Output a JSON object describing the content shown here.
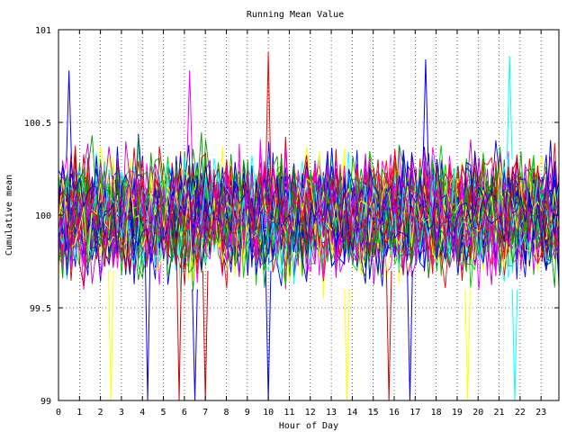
{
  "chart_data": {
    "type": "line",
    "title": "Running Mean Value",
    "xlabel": "Hour of Day",
    "ylabel": "Cumulative mean",
    "xlim": [
      0,
      23.85
    ],
    "ylim": [
      99,
      101
    ],
    "x_ticks": [
      "0",
      "1",
      "2",
      "3",
      "4",
      "5",
      "6",
      "7",
      "8",
      "9",
      "10",
      "11",
      "12",
      "13",
      "14",
      "15",
      "16",
      "17",
      "18",
      "19",
      "20",
      "21",
      "22",
      "23"
    ],
    "y_ticks": [
      "99",
      "99.5",
      "100",
      "100.5",
      "101"
    ],
    "grid": true,
    "legend": "none",
    "series_count": 60,
    "points_per_series": 120,
    "center_value": 100,
    "typical_spread": 0.3,
    "series_colors": [
      "#ff0000",
      "#00cc00",
      "#0000ff",
      "#ff00ff",
      "#00ffff",
      "#ffff00",
      "#cc0000",
      "#009900",
      "#0000cc",
      "#cc00cc"
    ],
    "spikes": [
      {
        "color": "#ffff00",
        "x": 2.5,
        "y_from": 99.7,
        "y_to": 99.0
      },
      {
        "color": "#0000ff",
        "x": 4.25,
        "y_from": 99.8,
        "y_to": 99.0
      },
      {
        "color": "#cc0000",
        "x": 5.75,
        "y_from": 99.8,
        "y_to": 99.0
      },
      {
        "color": "#0000ff",
        "x": 6.5,
        "y_from": 99.6,
        "y_to": 99.0
      },
      {
        "color": "#cc0000",
        "x": 7.0,
        "y_from": 99.7,
        "y_to": 99.0
      },
      {
        "color": "#0000ff",
        "x": 10.0,
        "y_from": 99.7,
        "y_to": 99.0
      },
      {
        "color": "#ffff00",
        "x": 13.75,
        "y_from": 99.6,
        "y_to": 99.0
      },
      {
        "color": "#cc0000",
        "x": 15.75,
        "y_from": 99.7,
        "y_to": 99.0
      },
      {
        "color": "#0000ff",
        "x": 16.75,
        "y_from": 99.7,
        "y_to": 99.0
      },
      {
        "color": "#ffff00",
        "x": 19.5,
        "y_from": 99.6,
        "y_to": 99.0
      },
      {
        "color": "#00ffff",
        "x": 21.75,
        "y_from": 99.6,
        "y_to": 99.0
      },
      {
        "color": "#ff0000",
        "x": 10.0,
        "y_from": 100.2,
        "y_to": 100.88
      },
      {
        "color": "#00ffff",
        "x": 21.5,
        "y_from": 100.3,
        "y_to": 100.86
      },
      {
        "color": "#0000ff",
        "x": 17.5,
        "y_from": 100.3,
        "y_to": 100.84
      },
      {
        "color": "#0000ff",
        "x": 0.5,
        "y_from": 100.3,
        "y_to": 100.78
      },
      {
        "color": "#ff00ff",
        "x": 6.25,
        "y_from": 100.3,
        "y_to": 100.78
      }
    ]
  }
}
